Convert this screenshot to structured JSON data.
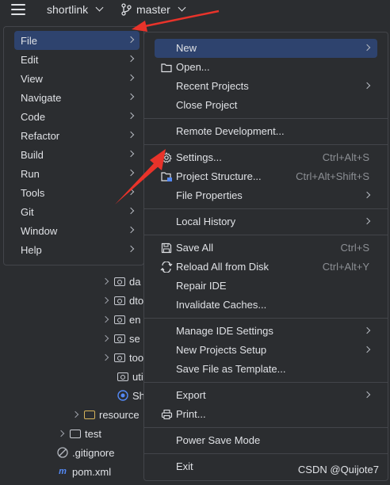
{
  "toolbar": {
    "project_name": "shortlink",
    "branch_name": "master"
  },
  "tree": {
    "items": [
      {
        "label": "da"
      },
      {
        "label": "dto"
      },
      {
        "label": "en"
      },
      {
        "label": "se"
      },
      {
        "label": "too"
      },
      {
        "label": "uti"
      },
      {
        "label": "Sh"
      },
      {
        "label": "resource"
      },
      {
        "label": "test"
      },
      {
        "label": ".gitignore"
      },
      {
        "label": "pom.xml"
      }
    ]
  },
  "main_menu": {
    "items": [
      {
        "label": "File"
      },
      {
        "label": "Edit"
      },
      {
        "label": "View"
      },
      {
        "label": "Navigate"
      },
      {
        "label": "Code"
      },
      {
        "label": "Refactor"
      },
      {
        "label": "Build"
      },
      {
        "label": "Run"
      },
      {
        "label": "Tools"
      },
      {
        "label": "Git"
      },
      {
        "label": "Window"
      },
      {
        "label": "Help"
      }
    ]
  },
  "file_menu": {
    "items": [
      {
        "label": "New"
      },
      {
        "label": "Open..."
      },
      {
        "label": "Recent Projects"
      },
      {
        "label": "Close Project"
      },
      {
        "label": "Remote Development..."
      },
      {
        "label": "Settings...",
        "shortcut": "Ctrl+Alt+S"
      },
      {
        "label": "Project Structure...",
        "shortcut": "Ctrl+Alt+Shift+S"
      },
      {
        "label": "File Properties"
      },
      {
        "label": "Local History"
      },
      {
        "label": "Save All",
        "shortcut": "Ctrl+S"
      },
      {
        "label": "Reload All from Disk",
        "shortcut": "Ctrl+Alt+Y"
      },
      {
        "label": "Repair IDE"
      },
      {
        "label": "Invalidate Caches..."
      },
      {
        "label": "Manage IDE Settings"
      },
      {
        "label": "New Projects Setup"
      },
      {
        "label": "Save File as Template..."
      },
      {
        "label": "Export"
      },
      {
        "label": "Print..."
      },
      {
        "label": "Power Save Mode"
      },
      {
        "label": "Exit"
      }
    ]
  },
  "watermark": "CSDN @Quijote7",
  "colors": {
    "background": "#2b2d30",
    "selected_item": "#2e436e",
    "annotation_arrow": "#e8332a",
    "shortcut_text": "#8c8f94"
  }
}
